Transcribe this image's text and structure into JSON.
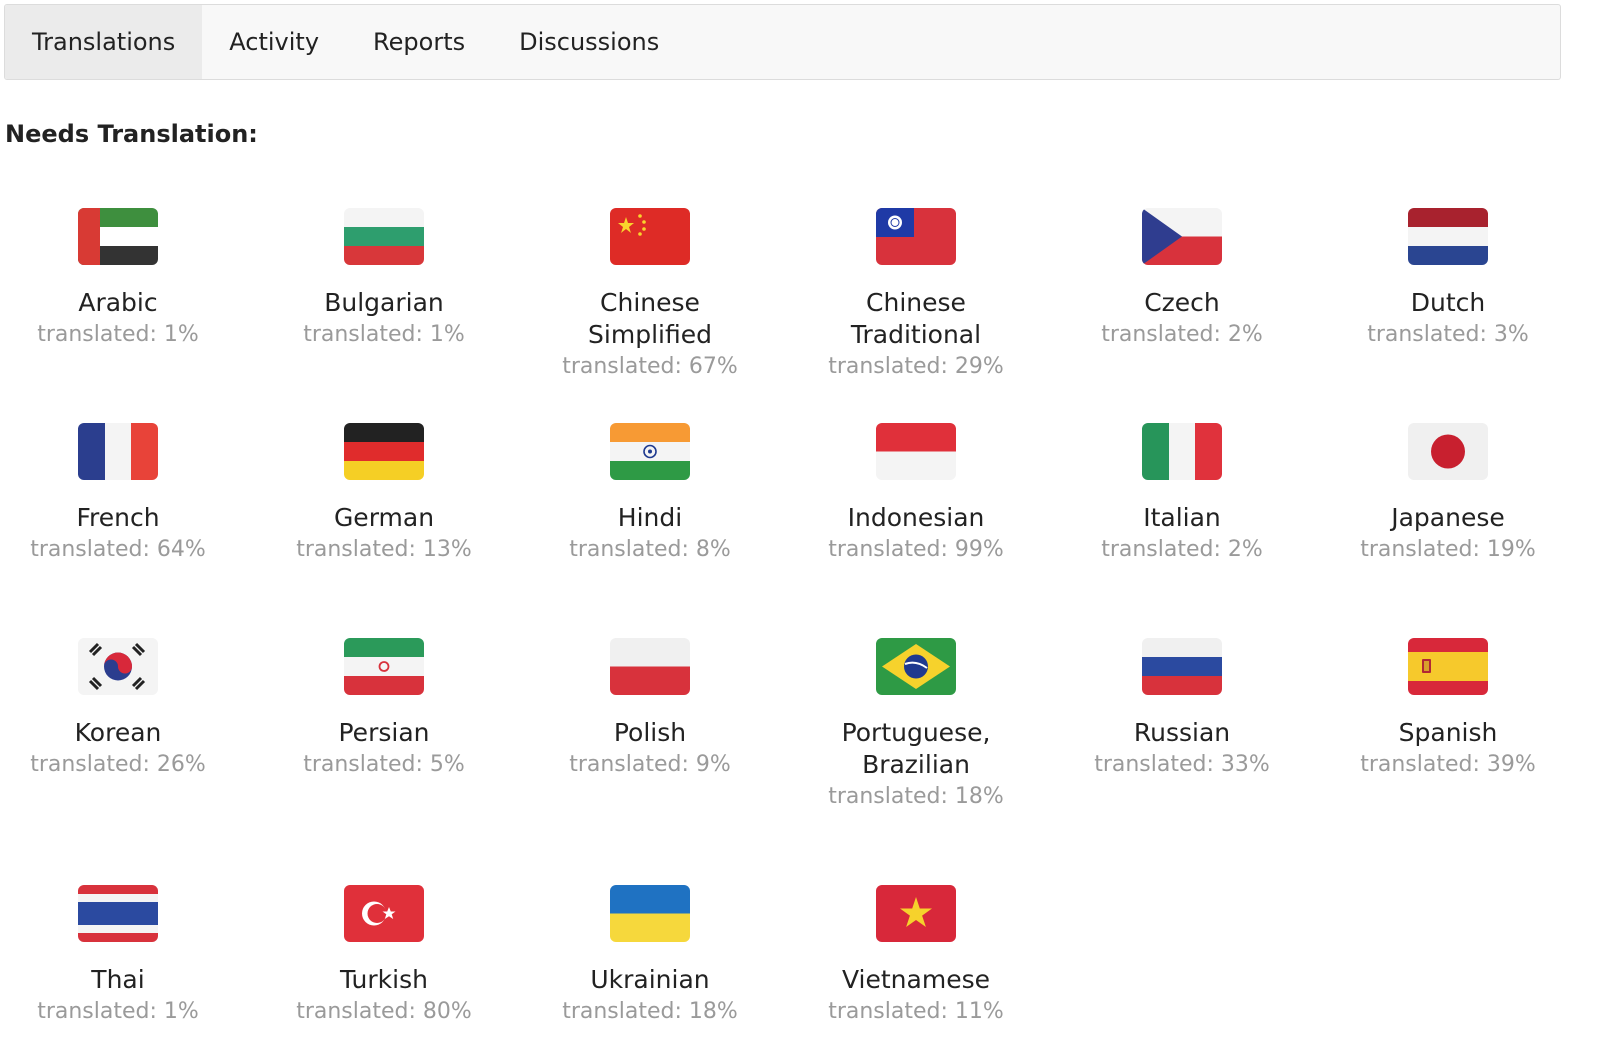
{
  "tabs": [
    "Translations",
    "Activity",
    "Reports",
    "Discussions"
  ],
  "section_title": "Needs Translation:",
  "languages": [
    {
      "name": "Arabic",
      "translated": "translated: 1%",
      "icon": "uae-flag-icon"
    },
    {
      "name": "Bulgarian",
      "translated": "translated: 1%",
      "icon": "bulgaria-flag-icon"
    },
    {
      "name": "Chinese Simplified",
      "translated": "translated: 67%",
      "icon": "china-flag-icon"
    },
    {
      "name": "Chinese Traditional",
      "translated": "translated: 29%",
      "icon": "taiwan-flag-icon"
    },
    {
      "name": "Czech",
      "translated": "translated: 2%",
      "icon": "czech-flag-icon"
    },
    {
      "name": "Dutch",
      "translated": "translated: 3%",
      "icon": "netherlands-flag-icon"
    },
    {
      "name": "French",
      "translated": "translated: 64%",
      "icon": "france-flag-icon"
    },
    {
      "name": "German",
      "translated": "translated: 13%",
      "icon": "germany-flag-icon"
    },
    {
      "name": "Hindi",
      "translated": "translated: 8%",
      "icon": "india-flag-icon"
    },
    {
      "name": "Indonesian",
      "translated": "translated: 99%",
      "icon": "indonesia-flag-icon"
    },
    {
      "name": "Italian",
      "translated": "translated: 2%",
      "icon": "italy-flag-icon"
    },
    {
      "name": "Japanese",
      "translated": "translated: 19%",
      "icon": "japan-flag-icon"
    },
    {
      "name": "Korean",
      "translated": "translated: 26%",
      "icon": "korea-flag-icon"
    },
    {
      "name": "Persian",
      "translated": "translated: 5%",
      "icon": "iran-flag-icon"
    },
    {
      "name": "Polish",
      "translated": "translated: 9%",
      "icon": "poland-flag-icon"
    },
    {
      "name": "Portuguese, Brazilian",
      "translated": "translated: 18%",
      "icon": "brazil-flag-icon"
    },
    {
      "name": "Russian",
      "translated": "translated: 33%",
      "icon": "russia-flag-icon"
    },
    {
      "name": "Spanish",
      "translated": "translated: 39%",
      "icon": "spain-flag-icon"
    },
    {
      "name": "Thai",
      "translated": "translated: 1%",
      "icon": "thailand-flag-icon"
    },
    {
      "name": "Turkish",
      "translated": "translated: 80%",
      "icon": "turkey-flag-icon"
    },
    {
      "name": "Ukrainian",
      "translated": "translated: 18%",
      "icon": "ukraine-flag-icon"
    },
    {
      "name": "Vietnamese",
      "translated": "translated: 11%",
      "icon": "vietnam-flag-icon"
    }
  ]
}
